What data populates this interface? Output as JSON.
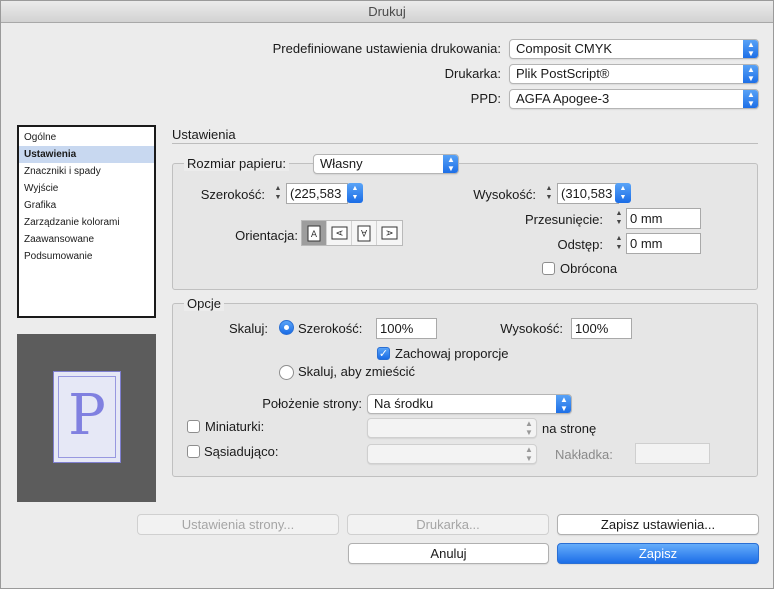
{
  "window": {
    "title": "Drukuj"
  },
  "top": {
    "preset_label": "Predefiniowane ustawienia drukowania:",
    "preset_value": "Composit CMYK",
    "printer_label": "Drukarka:",
    "printer_value": "Plik PostScript®",
    "ppd_label": "PPD:",
    "ppd_value": "AGFA Apogee-3"
  },
  "sidebar": {
    "items": [
      {
        "label": "Ogólne",
        "selected": false
      },
      {
        "label": "Ustawienia",
        "selected": true
      },
      {
        "label": "Znaczniki i spady",
        "selected": false
      },
      {
        "label": "Wyjście",
        "selected": false
      },
      {
        "label": "Grafika",
        "selected": false
      },
      {
        "label": "Zarządzanie kolorami",
        "selected": false
      },
      {
        "label": "Zaawansowane",
        "selected": false
      },
      {
        "label": "Podsumowanie",
        "selected": false
      }
    ]
  },
  "preview": {
    "letter": "P"
  },
  "section": {
    "title": "Ustawienia"
  },
  "paper": {
    "size_label": "Rozmiar papieru:",
    "size_value": "Własny",
    "width_label": "Szerokość:",
    "width_value": "(225,583",
    "height_label": "Wysokość:",
    "height_value": "(310,583",
    "orientation_label": "Orientacja:",
    "offset_label": "Przesunięcie:",
    "offset_value": "0 mm",
    "gap_label": "Odstęp:",
    "gap_value": "0 mm",
    "flipped_label": "Obrócona",
    "flipped_checked": false
  },
  "options": {
    "title": "Opcje",
    "scale_label": "Skaluj:",
    "scale_width_label": "Szerokość:",
    "scale_width_value": "100%",
    "scale_height_label": "Wysokość:",
    "scale_height_value": "100%",
    "keep_proportions_label": "Zachowaj proporcje",
    "keep_proportions_checked": true,
    "scale_to_fit_label": "Skaluj, aby zmieścić",
    "page_position_label": "Położenie strony:",
    "page_position_value": "Na środku",
    "thumbnails_label": "Miniaturki:",
    "per_page_label": "na stronę",
    "tile_label": "Sąsiadująco:",
    "overlap_label": "Nakładka:"
  },
  "buttons": {
    "page_setup": "Ustawienia strony...",
    "printer": "Drukarka...",
    "save_settings": "Zapisz ustawienia...",
    "cancel": "Anuluj",
    "save": "Zapisz"
  },
  "colors": {
    "accent": "#1c6ee8",
    "selection": "#c8d8f0",
    "preview_bg": "#5c5c5c"
  }
}
